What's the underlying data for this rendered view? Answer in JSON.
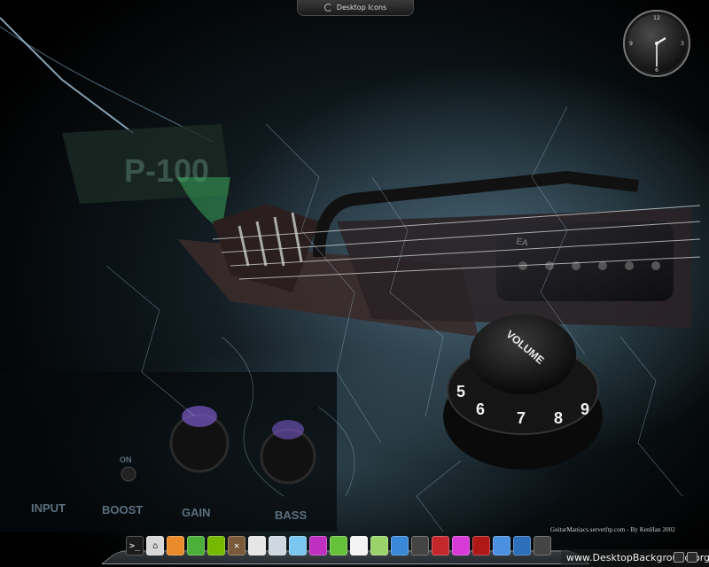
{
  "top_panel": {
    "label": "Desktop Icons"
  },
  "clock": {
    "numerals": [
      "12",
      "3",
      "6",
      "9"
    ]
  },
  "wallpaper": {
    "knob_label": "VOLUME",
    "knob_numbers": [
      "5",
      "6",
      "7",
      "8",
      "9"
    ],
    "amp_labels": [
      "INPUT",
      "BOOST",
      "GAIN",
      "BASS",
      "ON"
    ],
    "credit": "GuitarManiacs.servetftp.com - By KenHan 2002"
  },
  "dock": {
    "items": [
      {
        "icon": "terminal-icon",
        "glyph": ">_",
        "color": "#1b1b1b"
      },
      {
        "icon": "home-icon",
        "glyph": "⌂",
        "color": "#d8d8d8"
      },
      {
        "icon": "package-icon",
        "glyph": "",
        "color": "#e98b2a"
      },
      {
        "icon": "phone-icon",
        "glyph": "",
        "color": "#4caf3a"
      },
      {
        "icon": "nvidia-icon",
        "glyph": "",
        "color": "#76b900"
      },
      {
        "icon": "tools-icon",
        "glyph": "✕",
        "color": "#7b5a3a"
      },
      {
        "icon": "document-icon",
        "glyph": "",
        "color": "#e6e6e6"
      },
      {
        "icon": "thermometer-icon",
        "glyph": "",
        "color": "#cfd8e0"
      },
      {
        "icon": "drive-icon",
        "glyph": "",
        "color": "#7ac6ee"
      },
      {
        "icon": "eye-icon",
        "glyph": "",
        "color": "#c030c0"
      },
      {
        "icon": "android-icon",
        "glyph": "",
        "color": "#66c23a"
      },
      {
        "icon": "tux-icon",
        "glyph": "",
        "color": "#f3f3f3"
      },
      {
        "icon": "notes-icon",
        "glyph": "",
        "color": "#9bd36b"
      },
      {
        "icon": "monitor-icon",
        "glyph": "",
        "color": "#3a88d8"
      },
      {
        "icon": "network-icon",
        "glyph": "",
        "color": "#444"
      },
      {
        "icon": "ruby-icon",
        "glyph": "",
        "color": "#c4282c"
      },
      {
        "icon": "pink-app-icon",
        "glyph": "",
        "color": "#d83ad8"
      },
      {
        "icon": "red-app-icon",
        "glyph": "",
        "color": "#b01818"
      },
      {
        "icon": "chromium-icon",
        "glyph": "",
        "color": "#4a8fe0"
      },
      {
        "icon": "thunderbird-icon",
        "glyph": "",
        "color": "#2d6fb8"
      },
      {
        "icon": "trash-icon",
        "glyph": "",
        "color": "#444"
      }
    ]
  },
  "watermark": {
    "text": "www.DesktopBackground.org"
  },
  "tray": {
    "date_text": ""
  }
}
